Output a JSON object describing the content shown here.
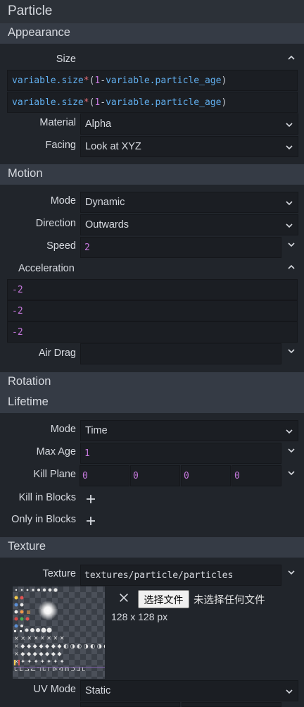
{
  "panel": {
    "title": "Particle"
  },
  "appearance": {
    "title": "Appearance",
    "size_label": "Size",
    "size_expr_1": {
      "a": "variable.size",
      "op": "*",
      "open": "(",
      "num": "1",
      "minus": "-",
      "b": "variable.particle_age",
      "close": ")"
    },
    "size_expr_2": {
      "a": "variable.size",
      "op": "*",
      "open": "(",
      "num": "1",
      "minus": "-",
      "b": "variable.particle_age",
      "close": ")"
    },
    "material_label": "Material",
    "material_value": "Alpha",
    "facing_label": "Facing",
    "facing_value": "Look at XYZ"
  },
  "motion": {
    "title": "Motion",
    "mode_label": "Mode",
    "mode_value": "Dynamic",
    "direction_label": "Direction",
    "direction_value": "Outwards",
    "speed_label": "Speed",
    "speed_value": "2",
    "acceleration_label": "Acceleration",
    "acceleration_values": [
      "-2",
      "-2",
      "-2"
    ],
    "air_drag_label": "Air Drag",
    "air_drag_value": ""
  },
  "rotation": {
    "title": "Rotation"
  },
  "lifetime": {
    "title": "Lifetime",
    "mode_label": "Mode",
    "mode_value": "Time",
    "max_age_label": "Max Age",
    "max_age_value": "1",
    "kill_plane_label": "Kill Plane",
    "kill_plane_values": [
      "0",
      "0",
      "0",
      "0"
    ],
    "kill_in_blocks_label": "Kill in Blocks",
    "only_in_blocks_label": "Only in Blocks"
  },
  "texture": {
    "title": "Texture",
    "texture_label": "Texture",
    "texture_path": "textures/particle/particles",
    "choose_file_label": "选择文件",
    "no_file_label": "未选择任何文件",
    "dimensions": "128 x 128 px",
    "uv_mode_label": "UV Mode",
    "uv_mode_value": "Static"
  },
  "icons": {
    "collapse": "chevron-up-icon",
    "expand": "chevron-down-icon",
    "add": "plus-icon",
    "clear": "close-icon"
  }
}
